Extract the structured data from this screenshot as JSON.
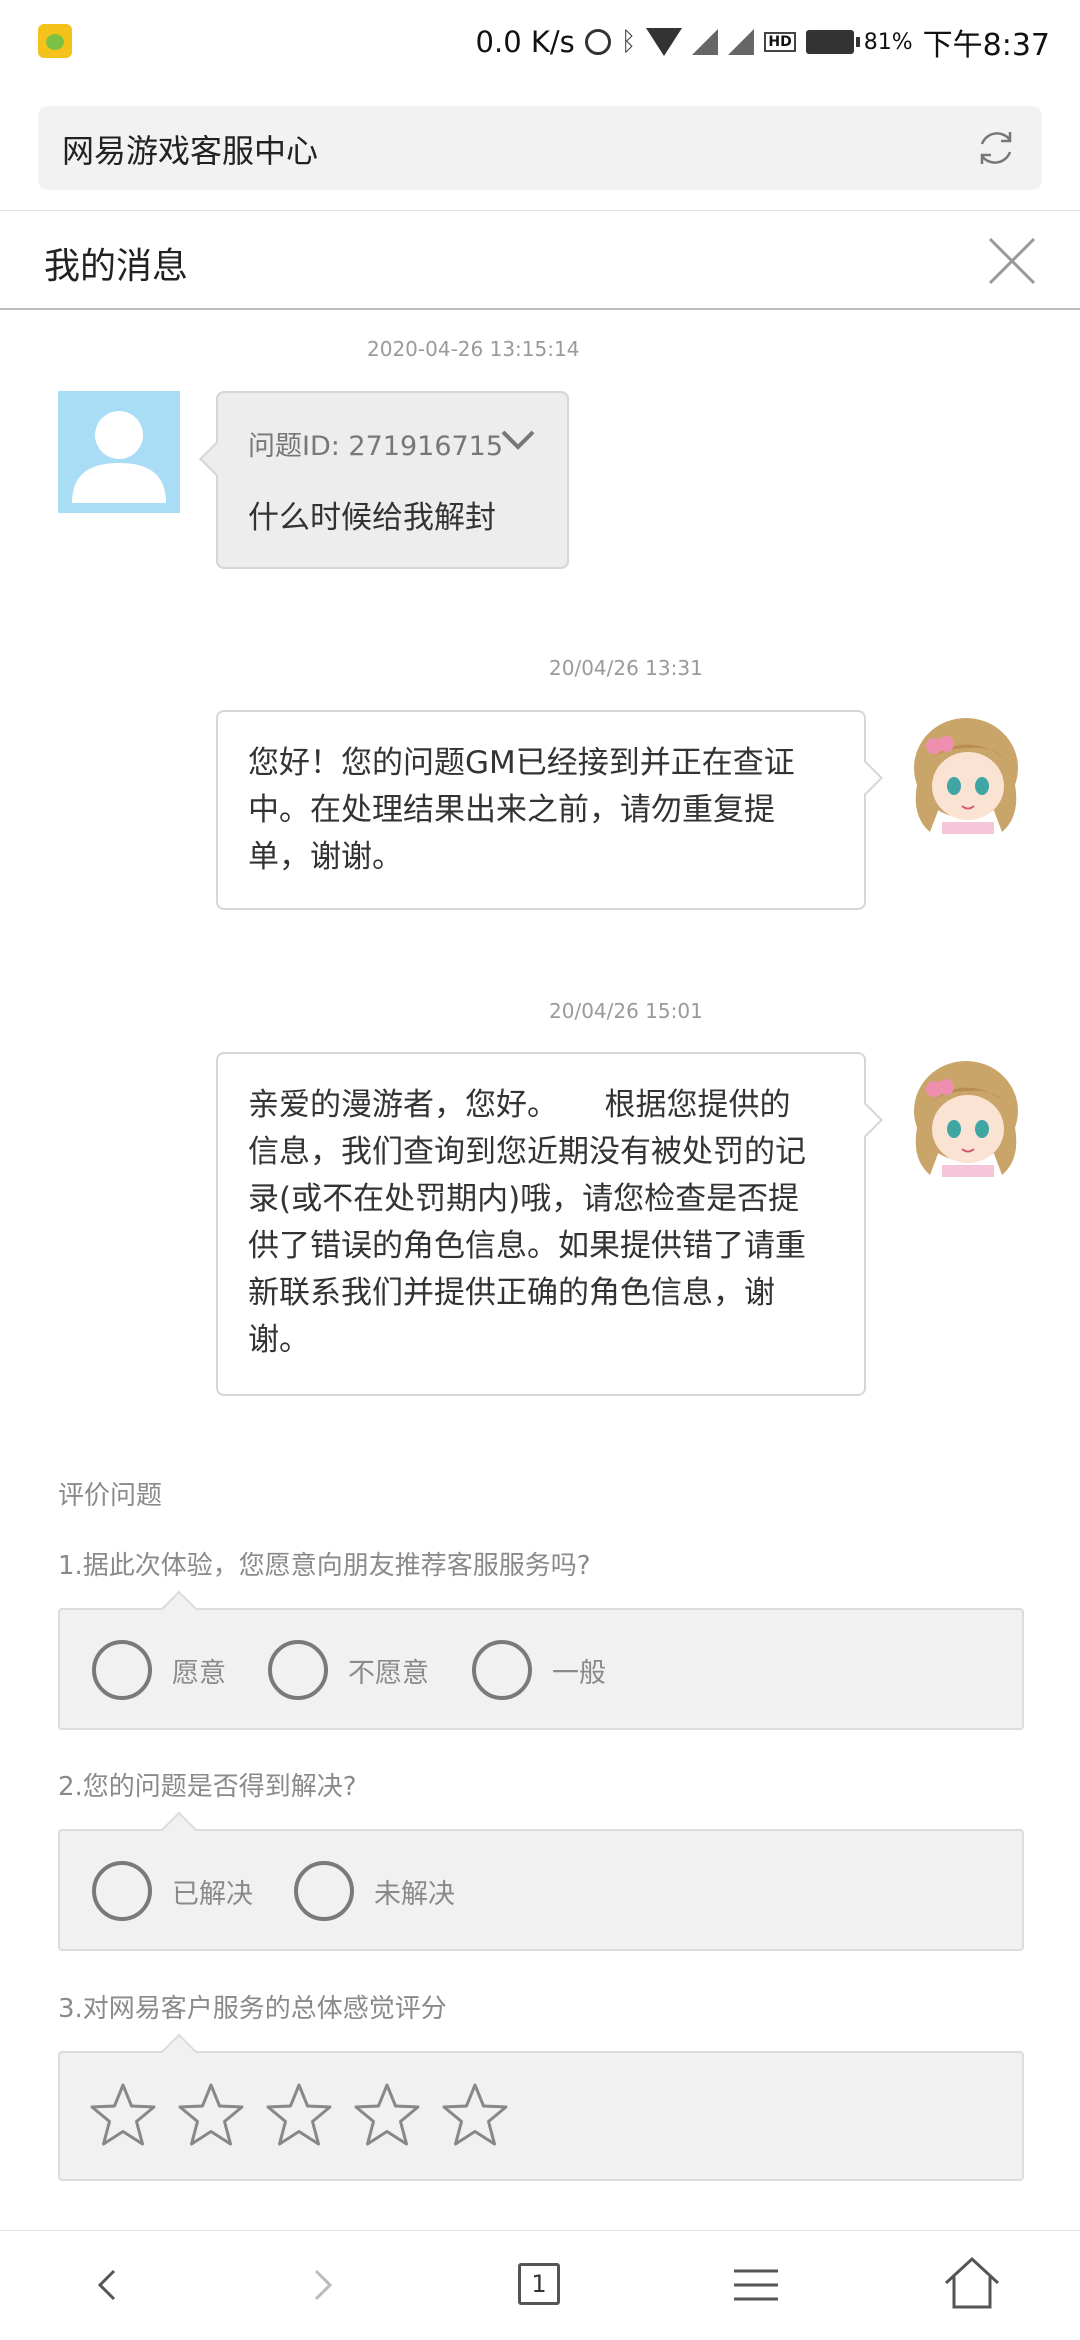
{
  "status_bar": {
    "speed": "0.0 K/s",
    "battery_pct": "81%",
    "time": "下午8:37",
    "icons": [
      "alarm-icon",
      "bluetooth-icon",
      "wifi-icon",
      "signal-icon",
      "hd-icon",
      "battery-icon"
    ]
  },
  "address_bar": {
    "title": "网易游戏客服中心",
    "refresh_icon": "refresh-icon"
  },
  "header": {
    "title": "我的消息",
    "close_icon": "close-icon"
  },
  "messages": [
    {
      "sender": "user",
      "timestamp": "2020-04-26 13:15:14",
      "question_id": "问题ID: 271916715",
      "text": "什么时候给我解封"
    },
    {
      "sender": "gm",
      "timestamp": "20/04/26 13:31",
      "lines": [
        "您好！您的问题GM已经接到并正在查证",
        "中。在处理结果出来之前，请勿重复提",
        "单，谢谢。"
      ]
    },
    {
      "sender": "gm",
      "timestamp": "20/04/26 15:01",
      "lines": [
        "亲爱的漫游者，您好。　　根据您提供的",
        "信息，我们查询到您近期没有被处罚的记",
        "录(或不在处罚期内)哦，请您检查是否提",
        "供了错误的角色信息。如果提供错了请重",
        "新联系我们并提供正确的角色信息，谢",
        "谢。"
      ]
    }
  ],
  "rating": {
    "title": "评价问题",
    "q1": {
      "text": "1.据此次体验，您愿意向朋友推荐客服服务吗?",
      "options": [
        "愿意",
        "不愿意",
        "一般"
      ],
      "selected": null
    },
    "q2": {
      "text": "2.您的问题是否得到解决?",
      "options": [
        "已解决",
        "未解决"
      ],
      "selected": null
    },
    "q3": {
      "text": "3.对网易客户服务的总体感觉评分",
      "stars_total": 5,
      "stars_selected": 0
    }
  },
  "bottom_nav": {
    "tab_count": "1",
    "icons": [
      "back-icon",
      "forward-icon",
      "tabs-icon",
      "menu-icon",
      "home-icon"
    ]
  },
  "colors": {
    "user_avatar_bg": "#a9dcf5",
    "user_bubble_bg": "#ededed",
    "gm_bubble_bg": "#ffffff",
    "option_box_bg": "#f1f1f1",
    "muted_text": "#8a8a8a"
  }
}
